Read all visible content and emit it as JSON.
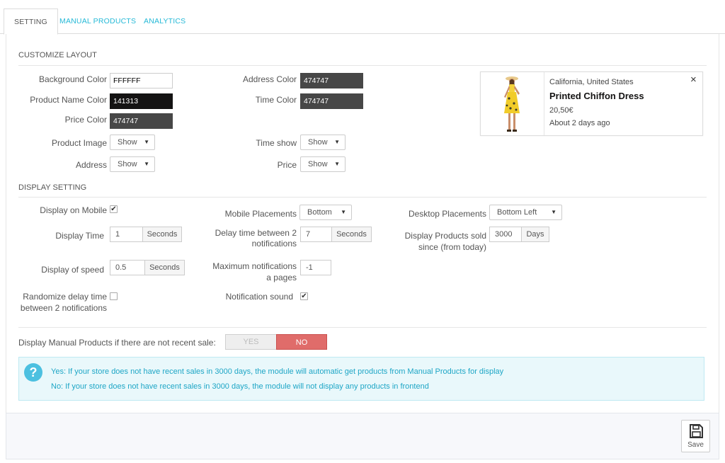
{
  "tabs": [
    {
      "label": "SETTING",
      "active": true
    },
    {
      "label": "MANUAL PRODUCTS",
      "active": false
    },
    {
      "label": "ANALYTICS",
      "active": false
    }
  ],
  "customize_layout": {
    "title": "CUSTOMIZE LAYOUT",
    "background_color": {
      "label": "Background Color",
      "value": "FFFFFF",
      "swatch": "#FFFFFF",
      "text_color": "#000000"
    },
    "product_name_color": {
      "label": "Product Name Color",
      "value": "141313",
      "swatch": "#141313",
      "text_color": "#ffffff"
    },
    "price_color": {
      "label": "Price Color",
      "value": "474747",
      "swatch": "#474747",
      "text_color": "#ffffff"
    },
    "address_color": {
      "label": "Address Color",
      "value": "474747",
      "swatch": "#474747",
      "text_color": "#ffffff"
    },
    "time_color": {
      "label": "Time Color",
      "value": "474747",
      "swatch": "#474747",
      "text_color": "#ffffff"
    },
    "product_image": {
      "label": "Product Image",
      "value": "Show"
    },
    "address": {
      "label": "Address",
      "value": "Show"
    },
    "time_show": {
      "label": "Time show",
      "value": "Show"
    },
    "price": {
      "label": "Price",
      "value": "Show"
    }
  },
  "preview": {
    "location": "California, United States",
    "product_name": "Printed Chiffon Dress",
    "price": "20,50€",
    "time": "About 2 days ago",
    "close_icon": "close-icon"
  },
  "display_setting": {
    "title": "DISPLAY SETTING",
    "display_on_mobile": {
      "label": "Display on Mobile",
      "checked": true
    },
    "display_time": {
      "label": "Display Time",
      "value": "1",
      "unit": "Seconds"
    },
    "display_of_speed": {
      "label": "Display of speed",
      "value": "0.5",
      "unit": "Seconds"
    },
    "randomize": {
      "label_line1": "Randomize delay time",
      "label_line2": "between 2 notifications",
      "checked": false
    },
    "mobile_placements": {
      "label": "Mobile Placements",
      "value": "Bottom"
    },
    "delay_time": {
      "label_line1": "Delay time between 2",
      "label_line2": "notifications",
      "value": "7",
      "unit": "Seconds"
    },
    "max_notifications": {
      "label_line1": "Maximum notifications",
      "label_line2": "a pages",
      "value": "-1"
    },
    "notification_sound": {
      "label": "Notification sound",
      "checked": true
    },
    "desktop_placements": {
      "label": "Desktop Placements",
      "value": "Bottom Left"
    },
    "products_sold_since": {
      "label_line1": "Display Products sold",
      "label_line2": "since (from today)",
      "value": "3000",
      "unit": "Days"
    }
  },
  "manual_products": {
    "label": "Display Manual Products if there are not recent sale:",
    "yes": "YES",
    "no": "NO",
    "selected": "NO"
  },
  "info": {
    "line1": "Yes: If your store does not have recent sales in 3000 days, the module will automatic get products from Manual Products for display",
    "line2": "No: If your store does not have recent sales in 3000 days, the module will not display any products in frontend"
  },
  "footer": {
    "save_label": "Save"
  },
  "colors": {
    "accent": "#25b9d7",
    "no_button": "#e06c6a",
    "info_bg": "#e9f8fb"
  }
}
